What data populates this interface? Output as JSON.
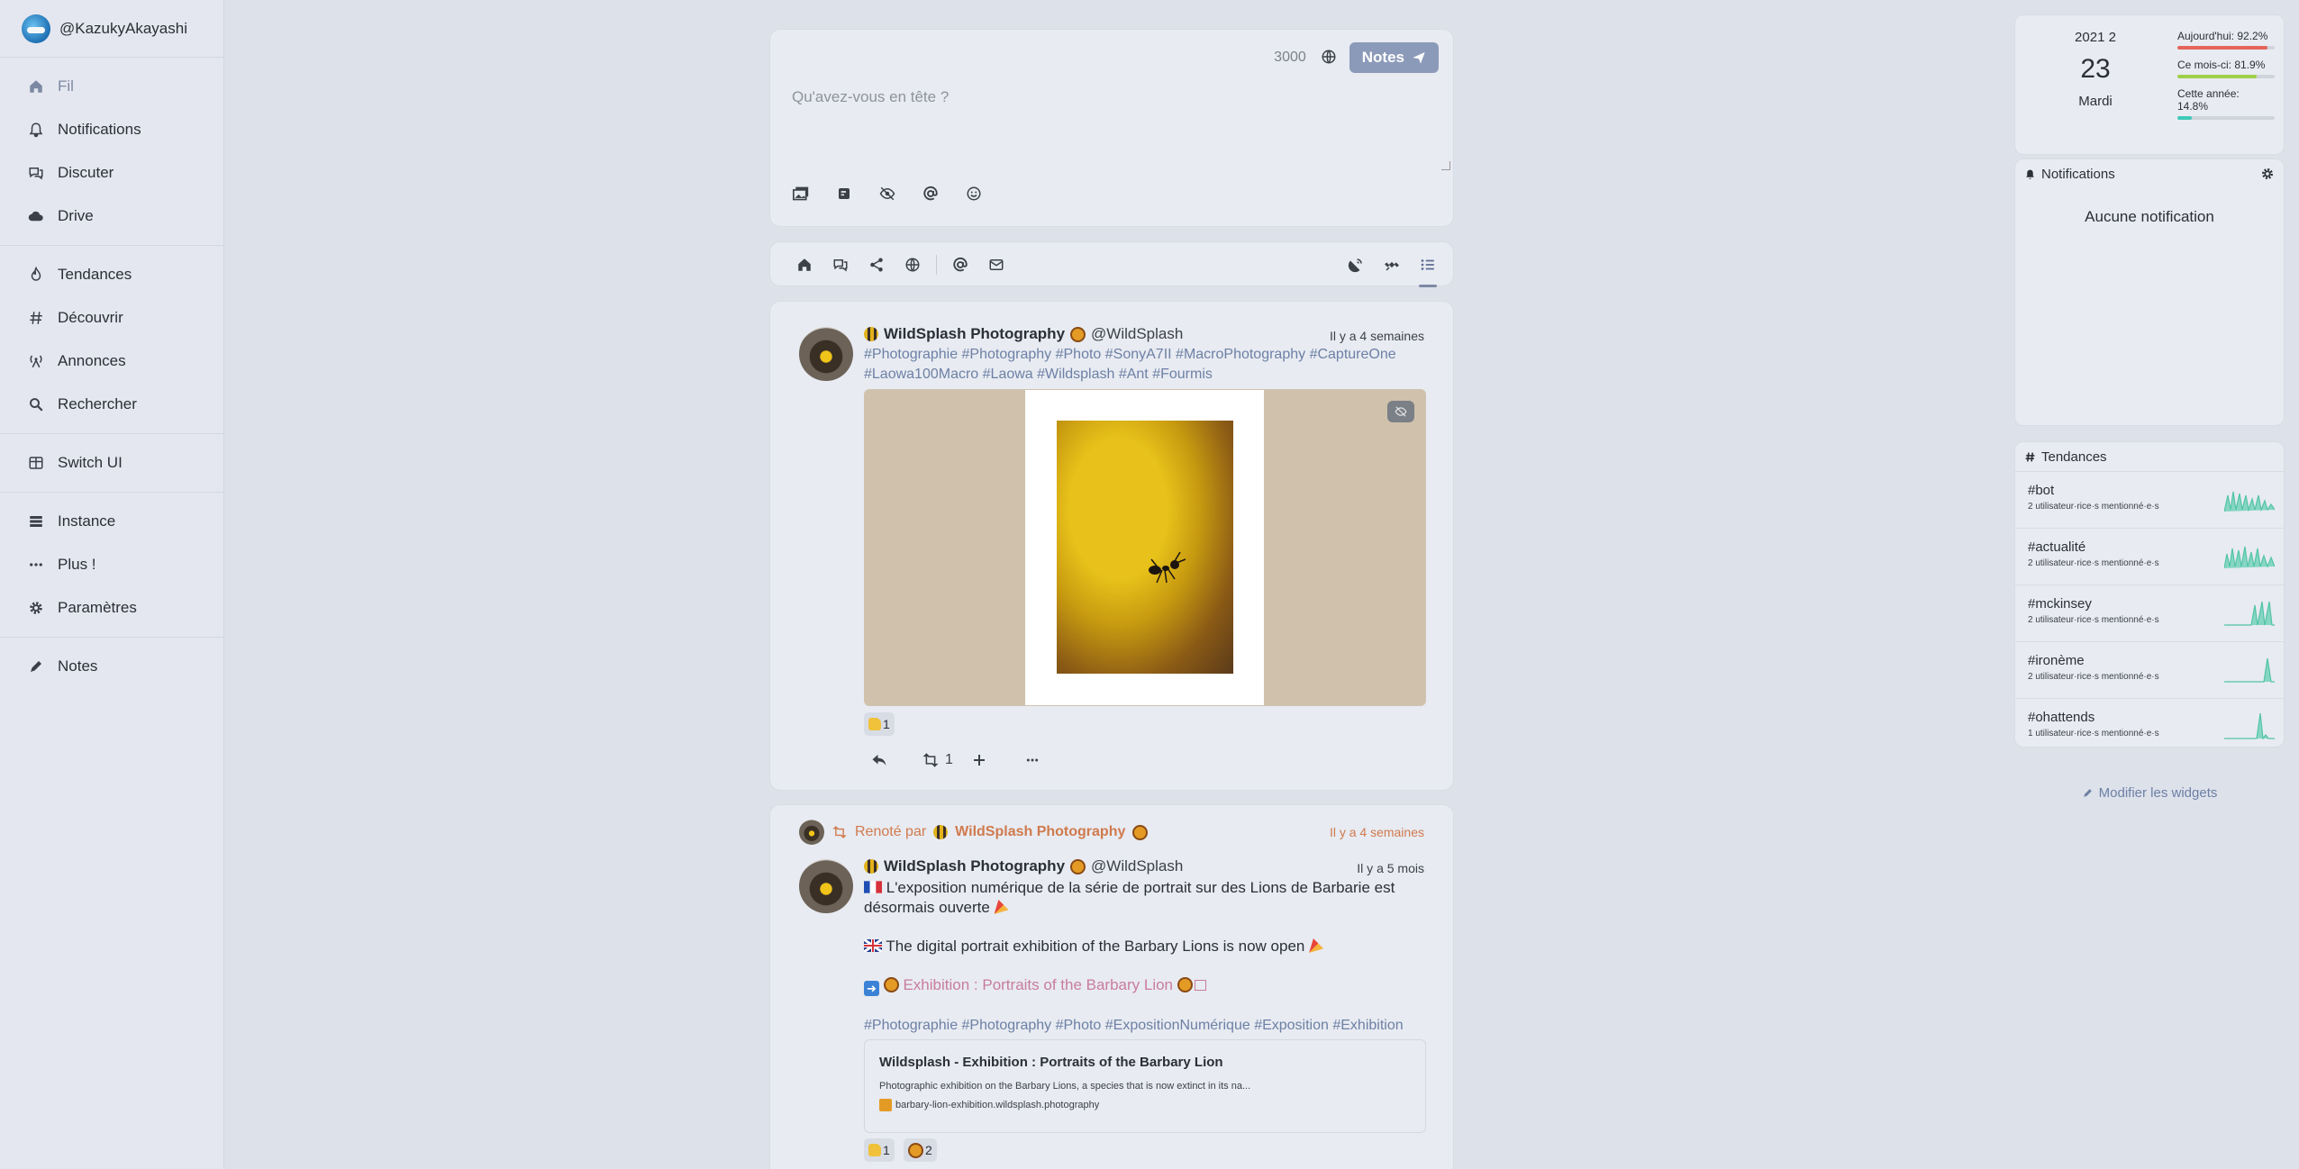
{
  "account": {
    "handle": "@KazukyAkayashi"
  },
  "sidebar": {
    "items": [
      {
        "label": "Fil",
        "icon": "home-icon"
      },
      {
        "label": "Notifications",
        "icon": "bell-icon"
      },
      {
        "label": "Discuter",
        "icon": "chat-icon"
      },
      {
        "label": "Drive",
        "icon": "cloud-icon"
      },
      {
        "label": "Tendances",
        "icon": "fire-icon"
      },
      {
        "label": "Découvrir",
        "icon": "hash-icon"
      },
      {
        "label": "Annonces",
        "icon": "broadcast-icon"
      },
      {
        "label": "Rechercher",
        "icon": "search-icon"
      },
      {
        "label": "Switch UI",
        "icon": "columns-icon"
      },
      {
        "label": "Instance",
        "icon": "server-icon"
      },
      {
        "label": "Plus !",
        "icon": "ellipsis-icon"
      },
      {
        "label": "Paramètres",
        "icon": "cog-icon"
      },
      {
        "label": "Notes",
        "icon": "pencil-icon"
      }
    ]
  },
  "composer": {
    "char_count": "3000",
    "submit_label": "Notes",
    "placeholder": "Qu'avez-vous en tête ?"
  },
  "post1": {
    "name": "WildSplash Photography",
    "handle": "@WildSplash",
    "time": "Il y a 4 semaines",
    "tags_line1": "#Photographie #Photography #Photo #SonyA7II #MacroPhotography #CaptureOne",
    "tags_line2": "#Laowa100Macro #Laowa #Wildsplash #Ant #Fourmis",
    "reaction_count": "1",
    "renote_count": "1"
  },
  "post2": {
    "renote_prefix": "Renoté par",
    "renoter_name": "WildSplash Photography",
    "renote_time": "Il y a 4 semaines",
    "name": "WildSplash Photography",
    "handle": "@WildSplash",
    "time": "Il y a 5 mois",
    "text_fr_1": "L'exposition numérique de la série de portrait sur des Lions de Barbarie est",
    "text_fr_2": "désormais ouverte",
    "text_en": "The digital portrait exhibition of the Barbary Lions is now open",
    "link_text": "Exhibition : Portraits of the Barbary Lion",
    "tags": "#Photographie #Photography #Photo #ExpositionNumérique #Exposition #Exhibition",
    "preview_title": "Wildsplash - Exhibition : Portraits of the Barbary Lion",
    "preview_desc": "Photographic exhibition on the Barbary Lions, a species that is now extinct in its na...",
    "preview_url": "barbary-lion-exhibition.wildsplash.photography",
    "reaction1_count": "1",
    "reaction2_count": "2"
  },
  "calendar": {
    "year_month": "2021 2",
    "day": "23",
    "weekday": "Mardi",
    "today_label": "Aujourd'hui:",
    "today_value": "92.2%",
    "today_frac": 0.922,
    "month_label": "Ce mois-ci:",
    "month_value": "81.9%",
    "month_frac": 0.819,
    "year_label": "Cette année:",
    "year_value": "14.8%",
    "year_frac": 0.148,
    "colors": {
      "today": "#e5645a",
      "month": "#9fd04a",
      "year": "#3ec9b8"
    }
  },
  "notifications_widget": {
    "title": "Notifications",
    "empty": "Aucune notification"
  },
  "trends_widget": {
    "title": "Tendances",
    "items": [
      {
        "tag": "#bot",
        "users": "2 utilisateur·rice·s mentionné·e·s"
      },
      {
        "tag": "#actualité",
        "users": "2 utilisateur·rice·s mentionné·e·s"
      },
      {
        "tag": "#mckinsey",
        "users": "2 utilisateur·rice·s mentionné·e·s"
      },
      {
        "tag": "#ironème",
        "users": "2 utilisateur·rice·s mentionné·e·s"
      },
      {
        "tag": "#ohattends",
        "users": "1 utilisateur·rice·s mentionné·e·s"
      }
    ]
  },
  "edit_widgets": "Modifier les widgets",
  "accent": "#7d89a4"
}
